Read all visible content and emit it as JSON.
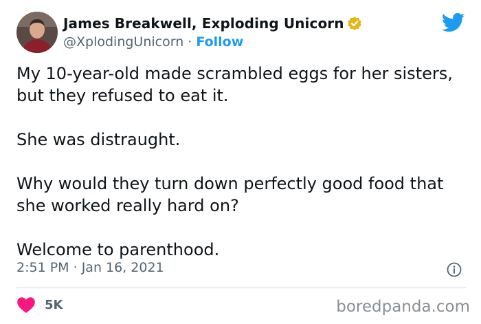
{
  "author": {
    "display_name": "James Breakwell, Exploding Unicorn",
    "handle": "@XplodingUnicorn",
    "separator": "·",
    "follow_label": "Follow",
    "verified_color": "#e2b719"
  },
  "tweet": {
    "paragraphs": [
      "My 10-year-old made scrambled eggs for her sisters, but they refused to eat it.",
      "She was distraught.",
      "Why would they turn down perfectly good food that she worked really hard on?",
      "Welcome to parenthood."
    ],
    "time": "2:51 PM",
    "date_separator": "·",
    "date": "Jan 16, 2021"
  },
  "engagement": {
    "likes": "5K"
  },
  "watermark": "boredpanda.com",
  "colors": {
    "accent": "#1d9bf0",
    "heart": "#f91880",
    "secondary_text": "#536471"
  },
  "icons": [
    "twitter-bird-icon",
    "verified-badge-icon",
    "info-icon",
    "heart-icon"
  ]
}
